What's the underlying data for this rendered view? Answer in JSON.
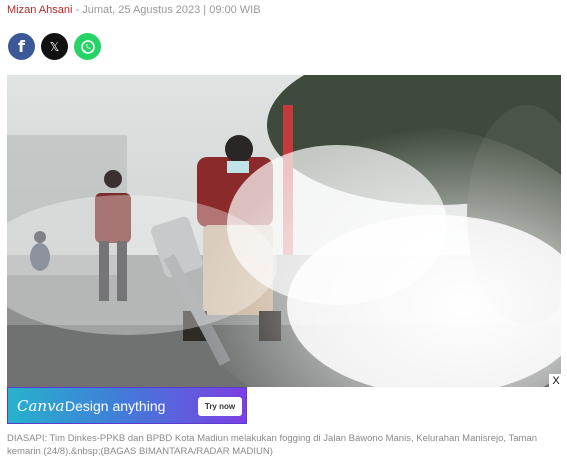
{
  "byline": {
    "author": "Mizan Ahsani",
    "date": " - Jumat, 25 Agustus 2023 | 09:00 WIB"
  },
  "share": {
    "facebook_glyph": "f",
    "x_glyph": "𝕏",
    "whatsapp_icon": "whatsapp-icon"
  },
  "ad": {
    "brand": "Canva",
    "tagline": "Design anything",
    "cta": "Try now",
    "close": "X"
  },
  "caption": "DIASAPI: Tim Dinkes-PPKB dan BPBD Kota Madiun melakukan fogging di Jalan Bawono Manis, Kelurahan Manisrejo, Taman kemarin (24/8).&nbsp;(BAGAS BIMANTARA/RADAR MADIUN)",
  "colors": {
    "author": "#b02a2a",
    "facebook": "#3b5998",
    "x": "#111111",
    "whatsapp": "#25d366",
    "canva_gradient_start": "#27b2cc",
    "canva_gradient_end": "#7b3fe4"
  }
}
